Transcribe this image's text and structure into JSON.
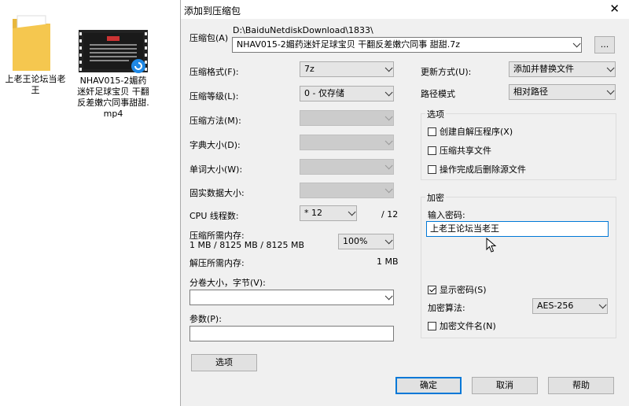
{
  "desktop": {
    "folder_label": "上老王论坛当老王",
    "video_label": "NHAV015-2媚药迷奸足球宝贝 干翻反差嫩穴同事甜甜.mp4"
  },
  "dialog": {
    "title": "添加到压缩包",
    "archive": {
      "label": "压缩包(A)",
      "path": "D:\\BaiduNetdiskDownload\\1833\\",
      "filename": "NHAV015-2媚药迷奸足球宝贝 干翻反差嫩穴同事 甜甜.7z",
      "browse": "..."
    },
    "format": {
      "label": "压缩格式(F):",
      "value": "7z"
    },
    "level": {
      "label": "压缩等级(L):",
      "value": "0 - 仅存储"
    },
    "method": {
      "label": "压缩方法(M):",
      "value": ""
    },
    "dict": {
      "label": "字典大小(D):",
      "value": ""
    },
    "word": {
      "label": "单词大小(W):",
      "value": ""
    },
    "solid": {
      "label": "固实数据大小:",
      "value": ""
    },
    "cpu": {
      "label": "CPU 线程数:",
      "value": "* 12",
      "max": "/ 12"
    },
    "mem_compress": {
      "label": "压缩所需内存:",
      "detail": "1 MB / 8125 MB / 8125 MB",
      "percent": "100%"
    },
    "mem_decompress": {
      "label": "解压所需内存:",
      "value": "1 MB"
    },
    "volume": {
      "label": "分卷大小，字节(V):",
      "value": ""
    },
    "params": {
      "label": "参数(P):",
      "value": ""
    },
    "options_button": "选项",
    "update": {
      "label": "更新方式(U):",
      "value": "添加并替换文件"
    },
    "pathmode": {
      "label": "路径模式",
      "value": "相对路径"
    },
    "options_group": {
      "title": "选项",
      "sfx": "创建自解压程序(X)",
      "shared": "压缩共享文件",
      "delete": "操作完成后删除源文件"
    },
    "encryption": {
      "title": "加密",
      "password_label": "输入密码:",
      "password_value": "上老王论坛当老王",
      "show_password": "显示密码(S)",
      "method_label": "加密算法:",
      "method_value": "AES-256",
      "encrypt_names": "加密文件名(N)"
    },
    "buttons": {
      "ok": "确定",
      "cancel": "取消",
      "help": "帮助"
    }
  },
  "colors": {
    "dialog_bg": "#f0f0f0",
    "accent": "#0078d7",
    "folder": "#f5c74f"
  }
}
